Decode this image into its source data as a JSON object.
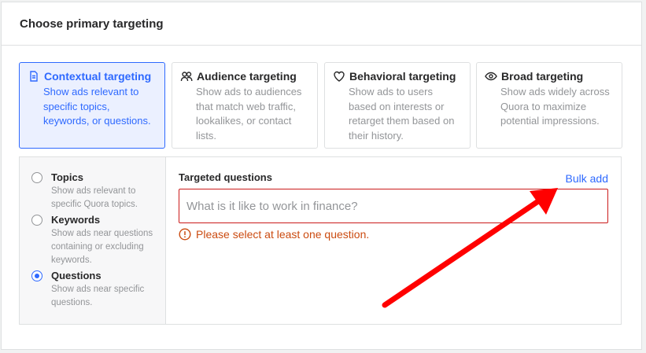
{
  "header": {
    "title": "Choose primary targeting"
  },
  "targeting_cards": [
    {
      "title": "Contextual targeting",
      "desc": "Show ads relevant to specific topics, keywords, or questions.",
      "icon": "document-icon",
      "selected": true
    },
    {
      "title": "Audience targeting",
      "desc": "Show ads to audiences that match web traffic, lookalikes, or contact lists.",
      "icon": "people-icon",
      "selected": false
    },
    {
      "title": "Behavioral targeting",
      "desc": "Show ads to users based on interests or retarget them based on their history.",
      "icon": "heart-icon",
      "selected": false
    },
    {
      "title": "Broad targeting",
      "desc": "Show ads widely across Quora to maximize potential impressions.",
      "icon": "eye-icon",
      "selected": false
    }
  ],
  "options": [
    {
      "title": "Topics",
      "desc": "Show ads relevant to specific Quora topics.",
      "selected": false
    },
    {
      "title": "Keywords",
      "desc": "Show ads near questions containing or excluding keywords.",
      "selected": false
    },
    {
      "title": "Questions",
      "desc": "Show ads near specific questions.",
      "selected": true
    }
  ],
  "questions": {
    "label": "Targeted questions",
    "bulk_add": "Bulk add",
    "placeholder": "What is it like to work in finance?",
    "error": "Please select at least one question."
  },
  "colors": {
    "accent": "#2e69ff",
    "error": "#cb4b10",
    "arrow": "#ff0000"
  }
}
